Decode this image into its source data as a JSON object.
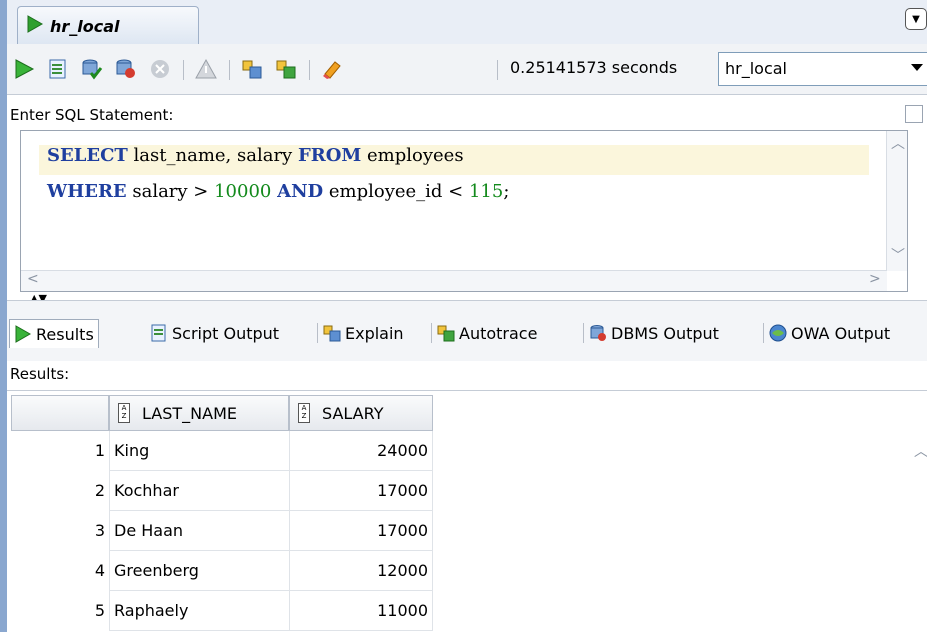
{
  "connection_tab": {
    "label": "hr_local"
  },
  "toolbar": {
    "timing": "0.25141573 seconds",
    "connection": "hr_local"
  },
  "statement": {
    "label": "Enter SQL Statement:",
    "line1": {
      "kw1": "SELECT",
      "t1": " last_name, salary ",
      "kw2": "FROM",
      "t2": " employees"
    },
    "line2": {
      "kw1": "WHERE",
      "t1": " salary > ",
      "n1": "10000",
      "t2": " ",
      "kw2": "AND",
      "t3": " employee_id < ",
      "n2": "115",
      "t4": ";"
    }
  },
  "result_tabs": [
    {
      "label": "Results",
      "icon": "run-icon"
    },
    {
      "label": "Script Output",
      "icon": "script-icon"
    },
    {
      "label": "Explain",
      "icon": "explain-icon"
    },
    {
      "label": "Autotrace",
      "icon": "autotrace-icon"
    },
    {
      "label": "DBMS Output",
      "icon": "dbms-icon"
    },
    {
      "label": "OWA Output",
      "icon": "owa-icon"
    }
  ],
  "results": {
    "label": "Results:",
    "columns": [
      "LAST_NAME",
      "SALARY"
    ],
    "rows": [
      {
        "num": "1",
        "last_name": "King",
        "salary": "24000"
      },
      {
        "num": "2",
        "last_name": "Kochhar",
        "salary": "17000"
      },
      {
        "num": "3",
        "last_name": "De Haan",
        "salary": "17000"
      },
      {
        "num": "4",
        "last_name": "Greenberg",
        "salary": "12000"
      },
      {
        "num": "5",
        "last_name": "Raphaely",
        "salary": "11000"
      }
    ]
  },
  "colors": {
    "keyword": "#1f3f9f",
    "number": "#138a1c",
    "accent": "#8aa7cf"
  }
}
